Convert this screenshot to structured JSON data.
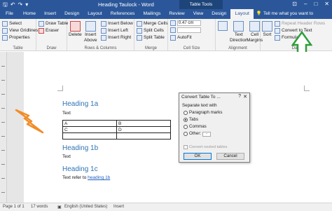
{
  "titlebar": {
    "title": "Heading Taulock - Word",
    "context_label": "Table Tools",
    "qat": {
      "save": "🖫",
      "undo": "↶",
      "redo": "↷",
      "customize": "▾"
    },
    "window": {
      "ribbon_options": "⊡",
      "minimize": "–",
      "maximize": "□",
      "close": "✕"
    }
  },
  "tabs": [
    "File",
    "Home",
    "Insert",
    "Design",
    "Layout",
    "References",
    "Mailings",
    "Review",
    "View",
    "Design",
    "Layout"
  ],
  "tellme": {
    "icon": "lightbulb-icon",
    "text": "Tell me what you want to"
  },
  "ribbon": {
    "table": {
      "select": "Select",
      "gridlines": "View Gridlines",
      "properties": "Properties",
      "label": "Table"
    },
    "draw": {
      "draw_table": "Draw Table",
      "eraser": "Eraser",
      "label": "Draw"
    },
    "rows_columns": {
      "delete": "Delete",
      "insert_above_1": "Insert",
      "insert_above_2": "Above",
      "below": "Insert Below",
      "left": "Insert Left",
      "right": "Insert Right",
      "label": "Rows & Columns"
    },
    "merge": {
      "merge": "Merge Cells",
      "split_cells": "Split Cells",
      "split_table": "Split Table",
      "label": "Merge"
    },
    "cell_size": {
      "height": "0.47 cm",
      "width": "",
      "autofit": "AutoFit",
      "label": "Cell Size"
    },
    "alignment": {
      "text_direction_1": "Text",
      "text_direction_2": "Direction",
      "margins_1": "Cell",
      "margins_2": "Margins",
      "label": "Alignment"
    },
    "data": {
      "sort": "Sort",
      "repeat_header": "Repeat Header Rows",
      "convert": "Convert to Text",
      "formula": "Formula",
      "label": "Data"
    }
  },
  "document": {
    "heading1a": "Heading 1a",
    "text1": "Text",
    "table": [
      [
        "A",
        "B"
      ],
      [
        "C",
        "D"
      ],
      [
        "",
        ""
      ]
    ],
    "heading1b": "Heading 1b",
    "text2": "Text",
    "heading1c": "Heading 1c",
    "text3_prefix": "Text refer to ",
    "text3_link": "heading 1b"
  },
  "dialog": {
    "title": "Convert Table To ...",
    "help": "?",
    "close": "✕",
    "section": "Separate text with",
    "options": [
      "Paragraph marks",
      "Tabs",
      "Commas",
      "Other:"
    ],
    "selected": "Tabs",
    "other_value": "-",
    "checkbox": "Convert nested tables",
    "ok": "OK",
    "cancel": "Cancel"
  },
  "status": {
    "page": "Page 1 of 1",
    "words": "17 words",
    "language": "English (United States)",
    "mode": "Insert"
  },
  "colors": {
    "word_blue": "#2b579a",
    "heading_blue": "#2e74b5",
    "arrow_green": "#2e9e3a",
    "bolt_orange": "#f28c28"
  }
}
